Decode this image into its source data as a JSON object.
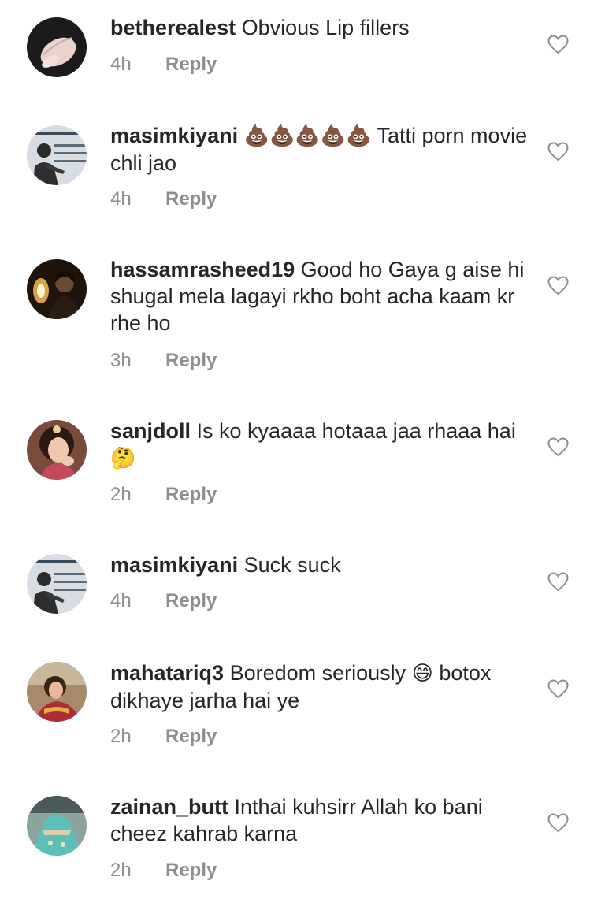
{
  "comments": [
    {
      "username": "betherealest",
      "text": "Obvious Lip fillers",
      "time": "4h",
      "reply_label": "Reply",
      "avatar_icon": "avatar-hand-photo"
    },
    {
      "username": "masimkiyani",
      "emoji": "💩💩💩💩💩",
      "text": "Tatti porn movie chli jao",
      "time": "4h",
      "reply_label": "Reply",
      "avatar_icon": "avatar-man-photo"
    },
    {
      "username": "hassamrasheed19",
      "text": "Good ho Gaya g aise hi shugal mela lagayi rkho boht acha kaam kr rhe ho",
      "time": "3h",
      "reply_label": "Reply",
      "avatar_icon": "avatar-man-lamp-photo"
    },
    {
      "username": "sanjdoll",
      "text": "Is ko kyaaaa hotaaa jaa rhaaa hai",
      "emoji": "🤔",
      "time": "2h",
      "reply_label": "Reply",
      "avatar_icon": "avatar-woman-photo"
    },
    {
      "username": "masimkiyani",
      "text": "Suck suck",
      "time": "4h",
      "reply_label": "Reply",
      "avatar_icon": "avatar-man-photo"
    },
    {
      "username": "mahatariq3",
      "text": "Boredom seriously",
      "emoji": "😄",
      "text2": "botox dikhaye jarha hai ye",
      "time": "2h",
      "reply_label": "Reply",
      "avatar_icon": "avatar-woman-outdoor-photo"
    },
    {
      "username": "zainan_butt",
      "text": "Inthai kuhsirr Allah ko bani cheez kahrab karna",
      "time": "2h",
      "reply_label": "Reply",
      "avatar_icon": "avatar-teal-dress-photo"
    }
  ],
  "icons": {
    "like": "heart-outline-icon"
  },
  "colors": {
    "meta_text": "#8e8e8e",
    "body_text": "#262626",
    "background": "#ffffff"
  }
}
